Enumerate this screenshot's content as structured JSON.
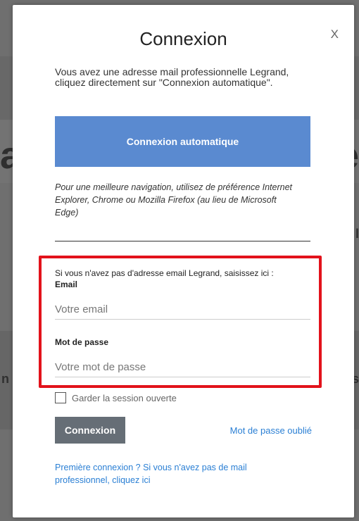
{
  "modal": {
    "title": "Connexion",
    "close_label": "X",
    "intro_text": "Vous avez une adresse mail professionnelle Legrand, cliquez directement sur \"Connexion automatique\".",
    "auto_login_label": "Connexion automatique",
    "browser_note": "Pour une meilleure navigation, utilisez de préférence Internet Explorer, Chrome ou Mozilla Firefox (au lieu de Microsoft Edge)",
    "form": {
      "intro": "Si vous n'avez pas d'adresse email Legrand, saisissez ici :",
      "email_label": "Email",
      "email_placeholder": "Votre email",
      "email_value": "",
      "password_label": "Mot de passe",
      "password_placeholder": "Votre mot de passe",
      "password_value": "",
      "keep_session_label": "Garder la session ouverte",
      "keep_session_checked": false,
      "submit_label": "Connexion",
      "forgot_label": "Mot de passe oublié",
      "first_login_label": "Première connexion ? Si vous n'avez pas de mail professionnel, cliquez ici"
    }
  },
  "colors": {
    "primary_button": "#5a8ad0",
    "submit_button": "#666e76",
    "link": "#2a7fd4",
    "highlight_border": "#e2121b",
    "overlay": "#6f6f6f"
  }
}
